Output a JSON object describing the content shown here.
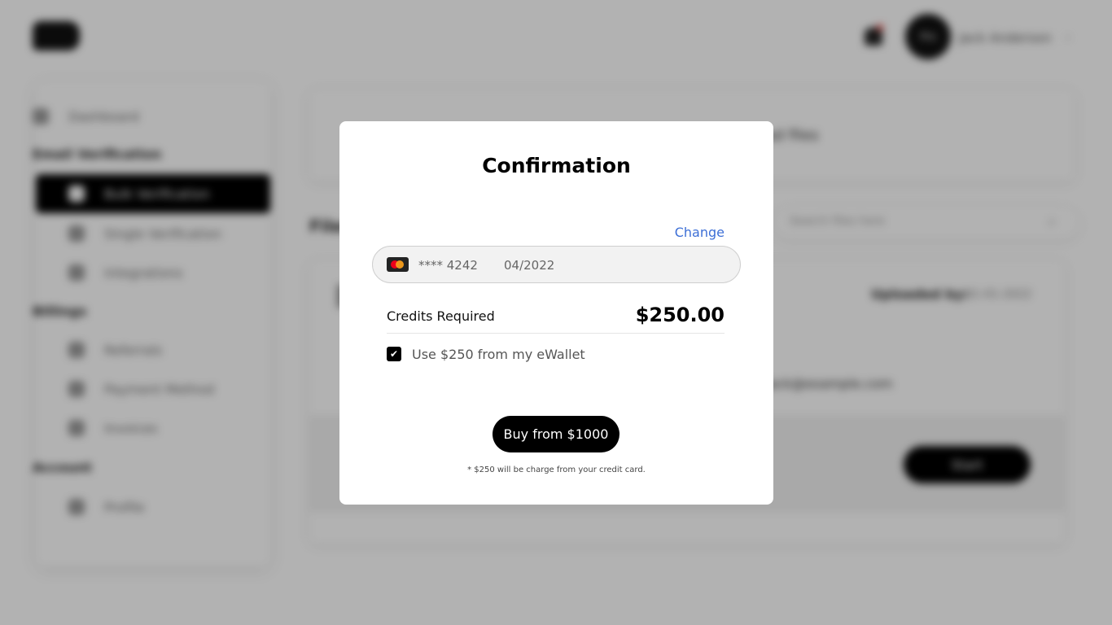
{
  "background": {
    "user_avatar_text": "Pro",
    "user_name": "Jack Anderson",
    "sidebar": {
      "items": [
        {
          "label": "Dashboard"
        },
        {
          "label": "Bulk Verification"
        },
        {
          "label": "Single Verification"
        },
        {
          "label": "Integrations"
        },
        {
          "label": "Referrals"
        },
        {
          "label": "Payment Method"
        },
        {
          "label": "Invoices"
        },
        {
          "label": "Profile"
        }
      ],
      "sections": [
        "Email Verification",
        "Billings",
        "Account"
      ]
    },
    "section_label": "Files",
    "search_placeholder": "Search files here",
    "card_top_text": "Upload files",
    "upload_label": "Uploaded by:",
    "upload_date": "01-01-2022",
    "email_text": "jack@example.com",
    "action_button": "Start"
  },
  "modal": {
    "title": "Confirmation",
    "change_link": "Change",
    "card": {
      "brand_icon": "mastercard-icon",
      "number": "**** 4242",
      "expiry": "04/2022"
    },
    "credits_label": "Credits Required",
    "credits_value": "$250.00",
    "wallet_checkbox_checked": true,
    "wallet_label": "Use $250 from my eWallet",
    "buy_button": "Buy from $1000",
    "footnote": "* $250 will be charge from your credit card."
  },
  "colors": {
    "accent_link": "#3d6fd6",
    "primary": "#000000",
    "overlay": "rgba(0,0,0,0.30)"
  }
}
